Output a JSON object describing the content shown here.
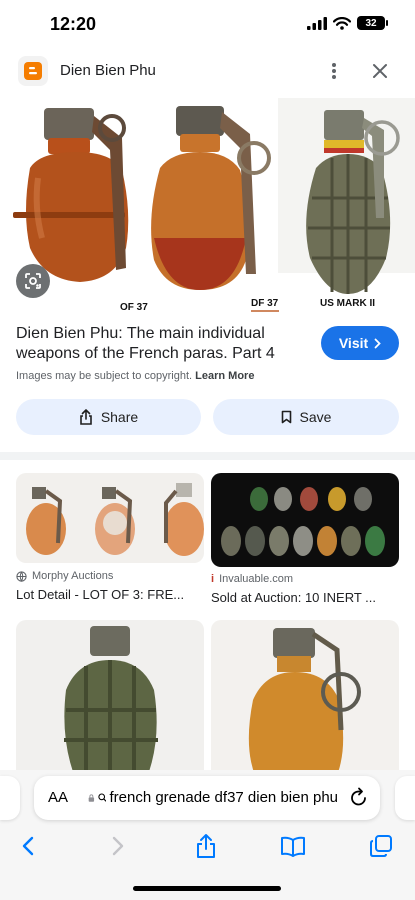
{
  "status_bar": {
    "time": "12:20",
    "battery": "32"
  },
  "header": {
    "site_title": "Dien Bien Phu"
  },
  "hero": {
    "label_1": "OF 37",
    "label_2": "DF 37",
    "label_3": "US MARK II"
  },
  "result": {
    "title": "Dien Bien Phu: The main individual weapons of the French paras. Part 4",
    "visit_label": "Visit",
    "copyright_note": "Images may be subject to copyright.",
    "learn_more": "Learn More"
  },
  "actions": {
    "share_label": "Share",
    "save_label": "Save"
  },
  "related": [
    {
      "source": "Morphy Auctions",
      "title": "Lot Detail - LOT OF 3: FRE..."
    },
    {
      "source": "Invaluable.com",
      "title": "Sold at Auction: 10 INERT ..."
    }
  ],
  "browser": {
    "aa_label": "AA",
    "url": "french grenade df37 dien bien phu"
  },
  "colors": {
    "accent": "#1a73e8",
    "pill_bg": "#e8f0fe",
    "ios_blue": "#007aff"
  },
  "icons": [
    "signal-icon",
    "wifi-icon",
    "battery-icon",
    "blogger-icon",
    "more-vert-icon",
    "close-icon",
    "lens-icon",
    "chevron-right-icon",
    "share-icon",
    "bookmark-icon",
    "globe-icon",
    "invaluable-icon",
    "lock-icon",
    "search-icon",
    "reload-icon",
    "back-icon",
    "forward-icon",
    "share-sheet-icon",
    "bookmarks-icon",
    "tabs-icon"
  ]
}
